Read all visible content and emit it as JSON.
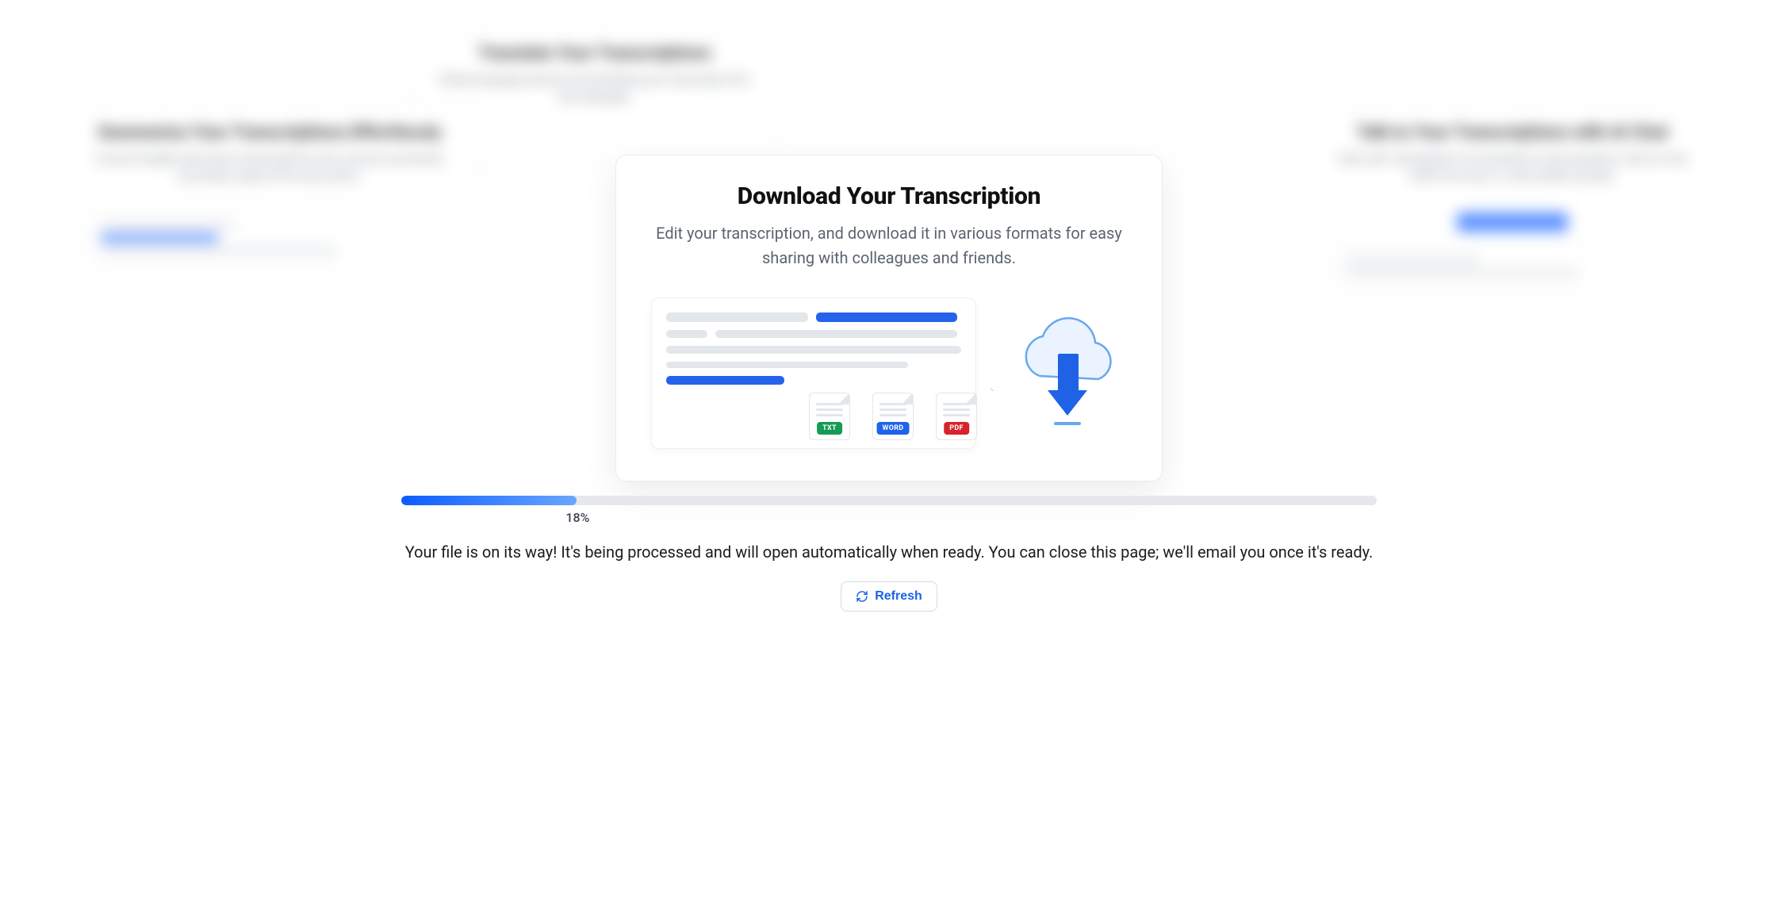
{
  "background": {
    "left": {
      "title": "Summarize Your Transcriptions Effortlessly",
      "subtitle": "Convert lengthy discussion transcriptions into concise summaries and easily capture the main points."
    },
    "top": {
      "title": "Translate Your Transcriptions",
      "subtitle": "Break language barriers by translating your transcripts into any language."
    },
    "right": {
      "title": "Talk to Your Transcriptions with AI Chat",
      "subtitle": "Chat with Transkriptor's AI assistant to ask questions, look for info within the chat, or verify details quickly."
    }
  },
  "modal": {
    "title": "Download Your Transcription",
    "subtitle": "Edit your transcription, and download it in various formats for easy sharing with colleagues and friends.",
    "formats": {
      "txt": "TXT",
      "word": "WORD",
      "pdf": "PDF"
    }
  },
  "progress": {
    "percent": 18,
    "label": "18%",
    "status": "Your file is on its way! It's being processed and will open automatically when ready. You can close this page; we'll email you once it's ready.",
    "refresh_label": "Refresh"
  }
}
